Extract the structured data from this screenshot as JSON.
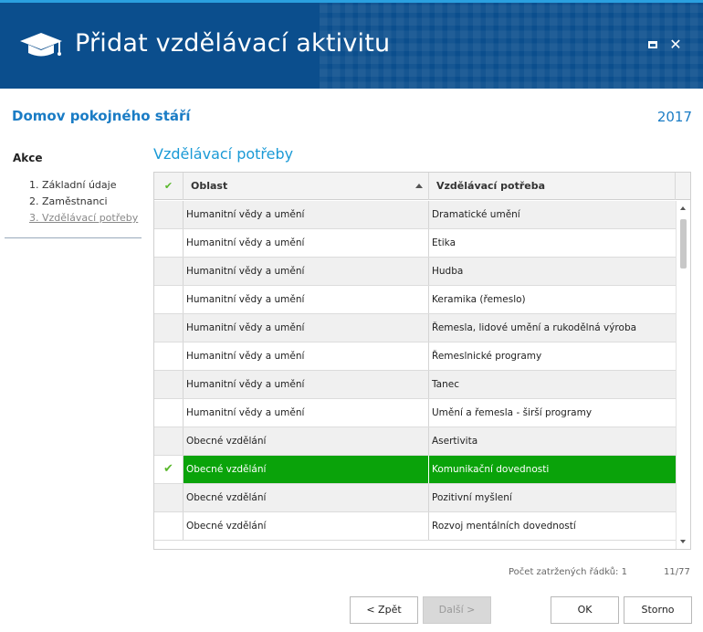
{
  "window": {
    "title": "Přidat vzdělávací aktivitu",
    "maximize_icon": "maximize-icon",
    "close_label": "✕"
  },
  "organization": "Domov pokojného stáří",
  "year": "2017",
  "nav": {
    "heading": "Akce",
    "items": [
      {
        "label": "1. Základní údaje",
        "active": false
      },
      {
        "label": "2. Zaměstnanci",
        "active": false
      },
      {
        "label": "3. Vzdělávací potřeby",
        "active": true
      }
    ]
  },
  "section_title": "Vzdělávací potřeby",
  "grid": {
    "columns": {
      "check": "✔",
      "area": "Oblast",
      "need": "Vzdělávací potřeba"
    },
    "sort_column": "area",
    "sort_direction": "ascending",
    "rows": [
      {
        "checked": false,
        "area": "Humanitní vědy a umění",
        "need": "Dramatické umění"
      },
      {
        "checked": false,
        "area": "Humanitní vědy a umění",
        "need": "Etika"
      },
      {
        "checked": false,
        "area": "Humanitní vědy a umění",
        "need": "Hudba"
      },
      {
        "checked": false,
        "area": "Humanitní vědy a umění",
        "need": "Keramika (řemeslo)"
      },
      {
        "checked": false,
        "area": "Humanitní vědy a umění",
        "need": "Řemesla, lidové umění a rukodělná výroba"
      },
      {
        "checked": false,
        "area": "Humanitní vědy a umění",
        "need": "Řemeslnické programy"
      },
      {
        "checked": false,
        "area": "Humanitní vědy a umění",
        "need": "Tanec"
      },
      {
        "checked": false,
        "area": "Humanitní vědy a umění",
        "need": "Umění a řemesla - širší programy"
      },
      {
        "checked": false,
        "area": "Obecné vzdělání",
        "need": "Asertivita"
      },
      {
        "checked": true,
        "area": "Obecné vzdělání",
        "need": "Komunikační dovednosti"
      },
      {
        "checked": false,
        "area": "Obecné vzdělání",
        "need": "Pozitivní myšlení"
      },
      {
        "checked": false,
        "area": "Obecné vzdělání",
        "need": "Rozvoj mentálních dovedností"
      }
    ]
  },
  "status": {
    "checked_count_label": "Počet zatržených řádků: 1",
    "page_counter": "11/77"
  },
  "buttons": {
    "back": "< Zpět",
    "next": "Další >",
    "ok": "OK",
    "cancel": "Storno"
  },
  "colors": {
    "header_bg": "#0b4e8d",
    "accent": "#1a7cc5",
    "selected_row": "#0aa30a",
    "check_green": "#5ab82c"
  }
}
